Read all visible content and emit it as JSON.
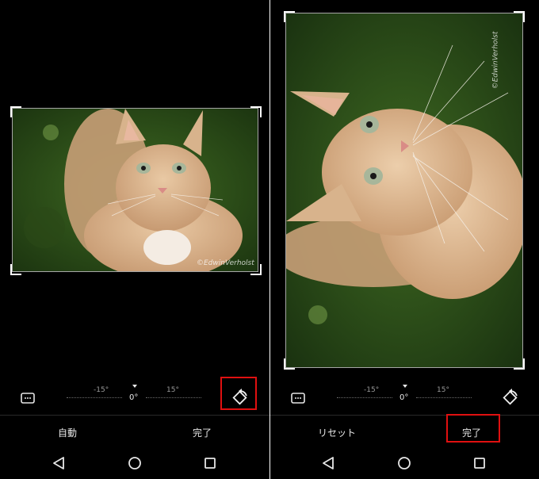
{
  "left_screen": {
    "watermark": "©EdwinVerholst",
    "rotation": {
      "neg_label": "-15°",
      "zero_label": "0°",
      "pos_label": "15°"
    },
    "actions": {
      "auto_label": "自動",
      "done_label": "完了"
    },
    "icons": [
      "aspect-ratio-icon",
      "rotate-icon"
    ],
    "highlighted": "rotate-button"
  },
  "right_screen": {
    "watermark": "©EdwinVerholst",
    "rotation": {
      "neg_label": "-15°",
      "zero_label": "0°",
      "pos_label": "15°"
    },
    "actions": {
      "reset_label": "リセット",
      "done_label": "完了"
    },
    "icons": [
      "aspect-ratio-icon",
      "rotate-icon"
    ],
    "highlighted": "done-button"
  },
  "navigation": [
    "back-icon",
    "home-icon",
    "recents-icon"
  ],
  "colors": {
    "background": "#000000",
    "highlight": "#e01010",
    "text": "#e6e6e6"
  }
}
